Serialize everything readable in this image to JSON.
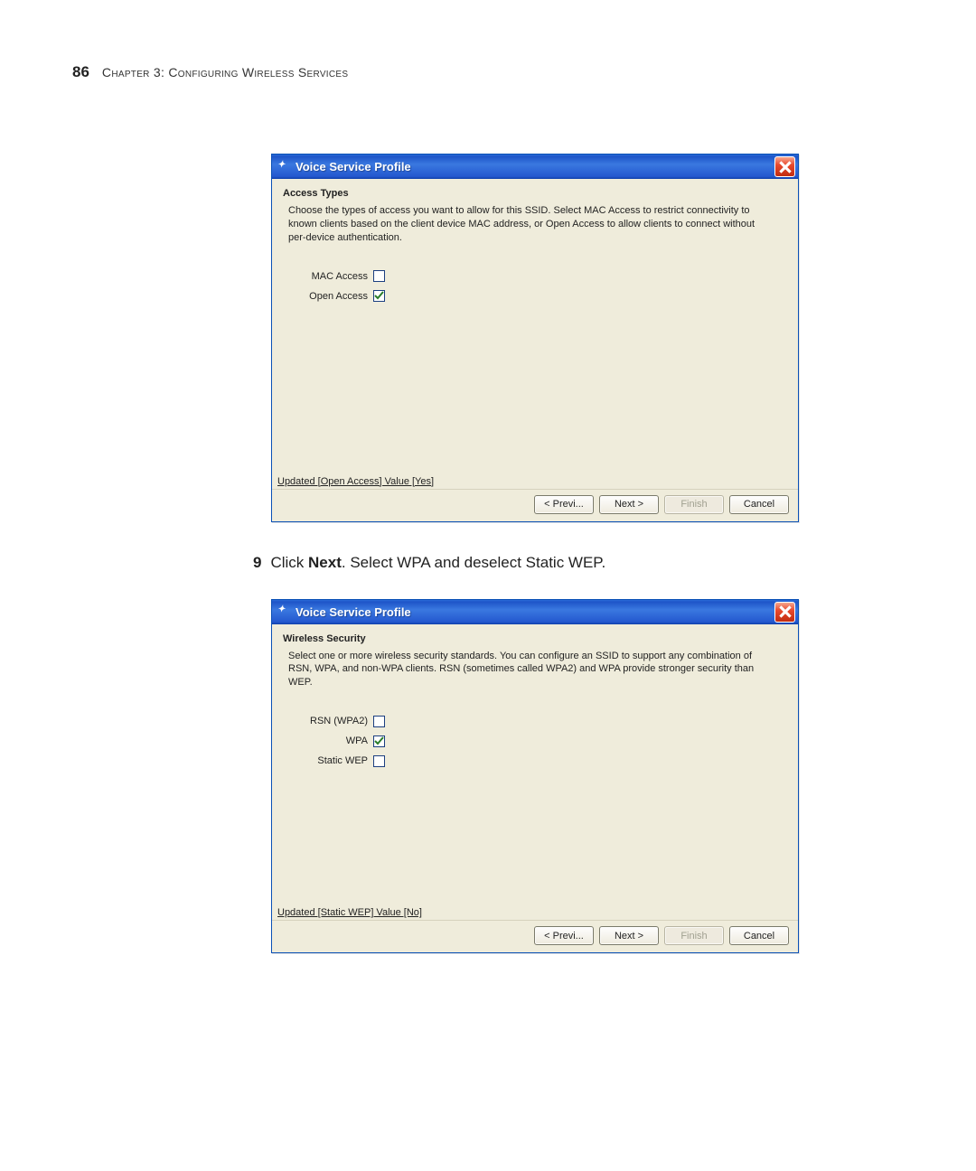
{
  "header": {
    "page_number": "86",
    "chapter": "Chapter 3: Configuring Wireless Services"
  },
  "dialog1": {
    "title": "Voice Service Profile",
    "section_heading": "Access Types",
    "section_desc": "Choose the types of access you want to allow for this SSID. Select MAC Access to restrict connectivity to known clients based on the client device MAC address, or Open Access to allow clients to connect without per-device authentication.",
    "options": [
      {
        "label": "MAC Access",
        "checked": false
      },
      {
        "label": "Open Access",
        "checked": true
      }
    ],
    "status": "Updated [Open Access] Value [Yes]",
    "buttons": {
      "prev": "< Previ...",
      "next": "Next >",
      "finish": "Finish",
      "cancel": "Cancel"
    }
  },
  "instruction": {
    "number": "9",
    "text_prefix": "Click ",
    "text_bold": "Next",
    "text_suffix": ". Select WPA and deselect Static WEP."
  },
  "dialog2": {
    "title": "Voice Service Profile",
    "section_heading": "Wireless Security",
    "section_desc": "Select one or more wireless security standards. You can configure an SSID to support any combination of RSN, WPA, and non-WPA clients. RSN (sometimes called WPA2) and WPA provide stronger security than WEP.",
    "options": [
      {
        "label": "RSN (WPA2)",
        "checked": false
      },
      {
        "label": "WPA",
        "checked": true
      },
      {
        "label": "Static WEP",
        "checked": false
      }
    ],
    "status": "Updated [Static WEP] Value [No]",
    "buttons": {
      "prev": "< Previ...",
      "next": "Next >",
      "finish": "Finish",
      "cancel": "Cancel"
    }
  }
}
